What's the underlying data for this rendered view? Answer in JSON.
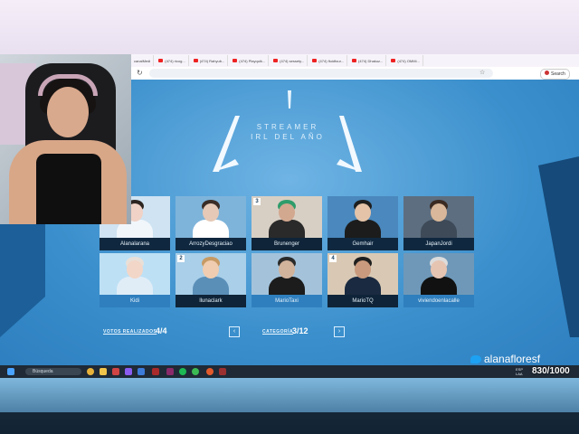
{
  "browser": {
    "tabs": [
      "canalMedi",
      "(474) ricog...",
      "(474) Rahyub...",
      "(474) Playquik...",
      "(474) sessety...",
      "(474) fluidfour...",
      "(474) Dhakuz...",
      "(474) OMMi..."
    ],
    "address": "",
    "profile_label": "Search"
  },
  "award": {
    "title_line1": "STREAMER",
    "title_line2": "IRL DEL AÑO"
  },
  "nominees": [
    {
      "name": "Alanalarana",
      "badge": "",
      "selected": false
    },
    {
      "name": "ArrozyDesgraciao",
      "badge": "",
      "selected": false
    },
    {
      "name": "Brunenger",
      "badge": "3",
      "selected": true
    },
    {
      "name": "Gemhair",
      "badge": "",
      "selected": false
    },
    {
      "name": "JapanJordi",
      "badge": "",
      "selected": false
    },
    {
      "name": "Kidi",
      "badge": "",
      "selected": false
    },
    {
      "name": "llunaclark",
      "badge": "2",
      "selected": true
    },
    {
      "name": "MarioTaxi",
      "badge": "",
      "selected": false
    },
    {
      "name": "MarioTQ",
      "badge": "4",
      "selected": true
    },
    {
      "name": "viviendoenlacalle",
      "badge": "",
      "selected": false
    }
  ],
  "footer": {
    "votes_label": "VOTOS REALIZADOS",
    "votes_value": "4/4",
    "category_label": "CATEGORÍA",
    "category_value": "3/12",
    "prev_label": "‹",
    "next_label": "›"
  },
  "taskbar": {
    "search_placeholder": "Búsqueda",
    "lang": "ESP LAA"
  },
  "overlay": {
    "handle": "alanafloresf",
    "counter": "830/1000"
  },
  "colors": {
    "page_bg": "#3a8fcc",
    "card_dark": "#0f2438",
    "card_light": "#2f7fbe",
    "twitter_blue": "#1da1f2"
  }
}
